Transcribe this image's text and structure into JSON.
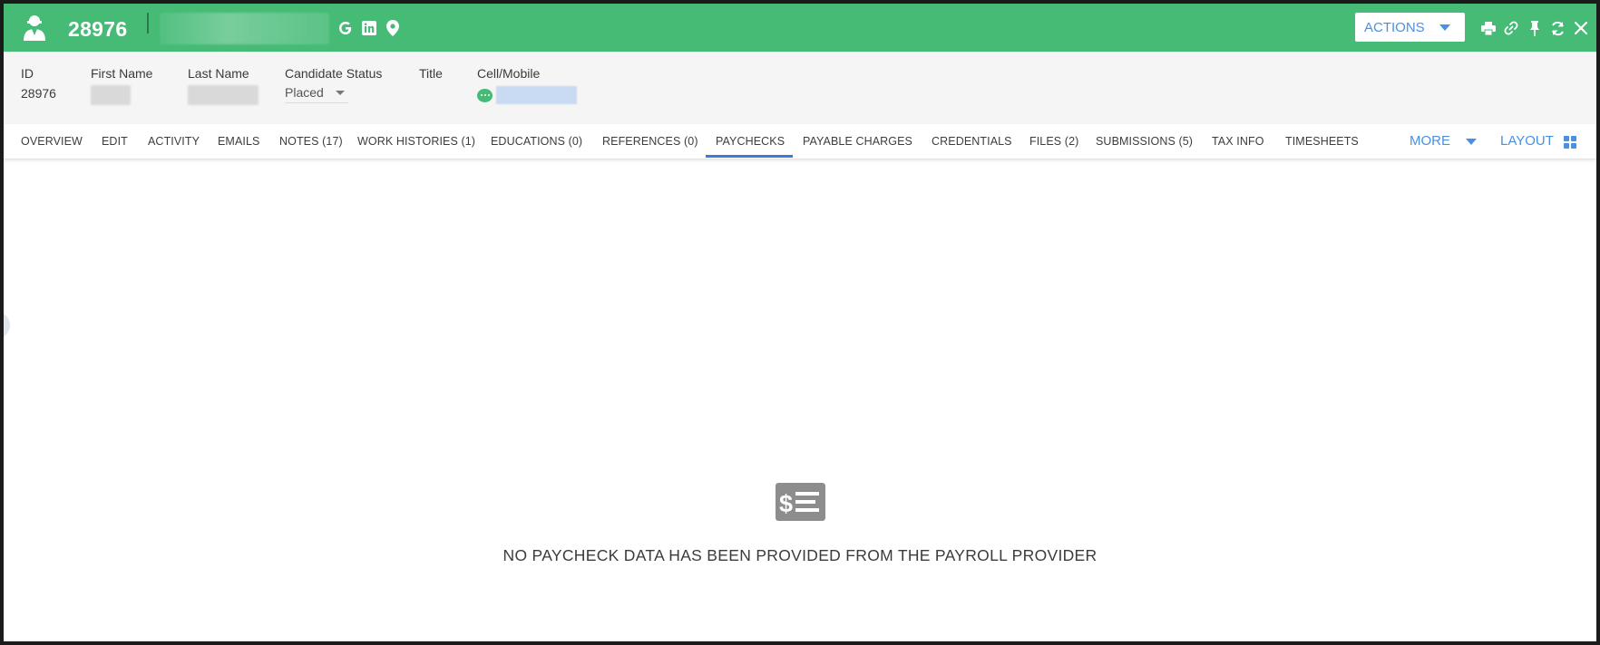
{
  "header": {
    "record_id": "28976",
    "candidate_icon": "candidate-person-icon",
    "social_icons": [
      "google-icon",
      "linkedin-icon",
      "map-pin-icon"
    ],
    "actions_label": "ACTIONS",
    "tool_icons": [
      "print-icon",
      "link-icon",
      "pin-icon",
      "refresh-icon",
      "close-icon"
    ],
    "accent_color": "#45bb76"
  },
  "info": {
    "id_label": "ID",
    "id_value": "28976",
    "first_name_label": "First Name",
    "last_name_label": "Last Name",
    "candidate_status_label": "Candidate Status",
    "candidate_status_value": "Placed",
    "title_label": "Title",
    "cell_label": "Cell/Mobile"
  },
  "tabs": [
    {
      "label": "OVERVIEW"
    },
    {
      "label": "EDIT"
    },
    {
      "label": "ACTIVITY"
    },
    {
      "label": "EMAILS"
    },
    {
      "label": "NOTES (17)"
    },
    {
      "label": "WORK HISTORIES (1)"
    },
    {
      "label": "EDUCATIONS (0)"
    },
    {
      "label": "REFERENCES (0)"
    },
    {
      "label": "PAYCHECKS",
      "active": true
    },
    {
      "label": "PAYABLE CHARGES"
    },
    {
      "label": "CREDENTIALS"
    },
    {
      "label": "FILES (2)"
    },
    {
      "label": "SUBMISSIONS (5)"
    },
    {
      "label": "TAX INFO"
    },
    {
      "label": "TIMESHEETS"
    }
  ],
  "more_label": "MORE",
  "layout_label": "LAYOUT",
  "empty_state": {
    "icon": "paycheck-icon",
    "message": "NO PAYCHECK DATA HAS BEEN PROVIDED FROM THE PAYROLL PROVIDER"
  }
}
